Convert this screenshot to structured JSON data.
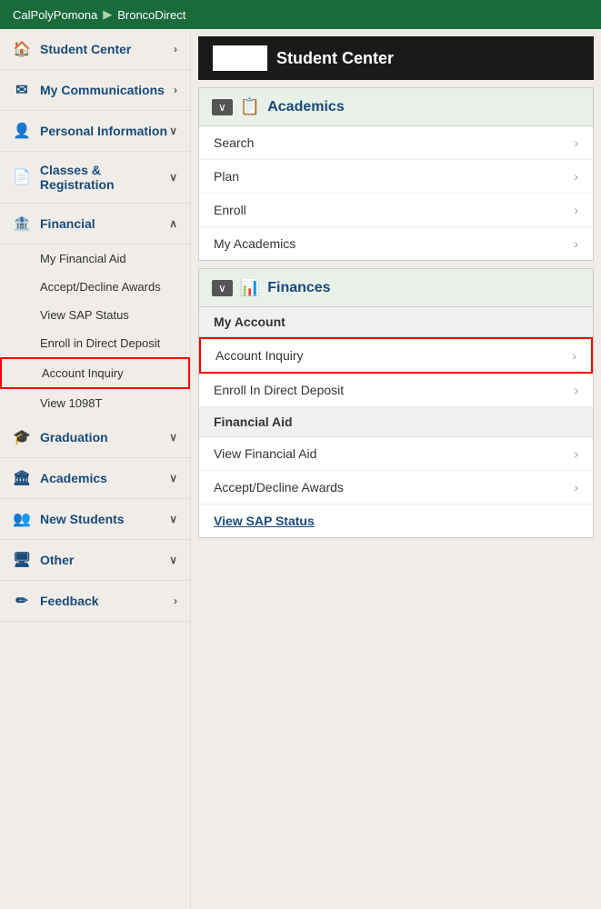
{
  "header": {
    "brand": "CalPolyPomona",
    "separator": "▶",
    "portal": "BroncoDirect"
  },
  "sidebar": {
    "items": [
      {
        "id": "student-center",
        "label": "Student Center",
        "icon": "🏠",
        "chevron": "›",
        "expanded": false,
        "submenu": []
      },
      {
        "id": "my-communications",
        "label": "My Communications",
        "icon": "✉",
        "chevron": "›",
        "expanded": false,
        "submenu": []
      },
      {
        "id": "personal-information",
        "label": "Personal Information",
        "icon": "👤",
        "chevron": "∨",
        "expanded": false,
        "submenu": []
      },
      {
        "id": "classes-registration",
        "label": "Classes & Registration",
        "icon": "📄",
        "chevron": "∨",
        "expanded": false,
        "submenu": []
      },
      {
        "id": "financial",
        "label": "Financial",
        "icon": "🏦",
        "chevron": "∧",
        "expanded": true,
        "submenu": [
          {
            "id": "my-financial-aid",
            "label": "My Financial Aid",
            "active": false
          },
          {
            "id": "accept-decline-awards",
            "label": "Accept/Decline Awards",
            "active": false
          },
          {
            "id": "view-sap-status",
            "label": "View SAP Status",
            "active": false
          },
          {
            "id": "enroll-direct-deposit",
            "label": "Enroll in Direct Deposit",
            "active": false
          },
          {
            "id": "account-inquiry",
            "label": "Account Inquiry",
            "active": true
          },
          {
            "id": "view-1098t",
            "label": "View 1098T",
            "active": false
          }
        ]
      },
      {
        "id": "graduation",
        "label": "Graduation",
        "icon": "🎓",
        "chevron": "∨",
        "expanded": false,
        "submenu": []
      },
      {
        "id": "academics",
        "label": "Academics",
        "icon": "🏛",
        "chevron": "∨",
        "expanded": false,
        "submenu": []
      },
      {
        "id": "new-students",
        "label": "New Students",
        "icon": "👥",
        "chevron": "∨",
        "expanded": false,
        "submenu": []
      },
      {
        "id": "other",
        "label": "Other",
        "icon": "🖥",
        "chevron": "∨",
        "expanded": false,
        "submenu": []
      },
      {
        "id": "feedback",
        "label": "Feedback",
        "icon": "✏",
        "chevron": "›",
        "expanded": false,
        "submenu": []
      }
    ]
  },
  "content": {
    "student_center_label": "Student Center",
    "academics_section": {
      "title": "Academics",
      "collapse_label": "∨",
      "items": [
        {
          "id": "search",
          "label": "Search"
        },
        {
          "id": "plan",
          "label": "Plan"
        },
        {
          "id": "enroll",
          "label": "Enroll"
        },
        {
          "id": "my-academics",
          "label": "My Academics"
        }
      ]
    },
    "finances_section": {
      "title": "Finances",
      "collapse_label": "∨",
      "groups": [
        {
          "header": "My Account",
          "items": [
            {
              "id": "account-inquiry",
              "label": "Account Inquiry",
              "highlighted": true
            },
            {
              "id": "enroll-direct-deposit",
              "label": "Enroll In Direct Deposit",
              "highlighted": false
            }
          ]
        },
        {
          "header": "Financial Aid",
          "items": [
            {
              "id": "view-financial-aid",
              "label": "View Financial Aid",
              "highlighted": false
            },
            {
              "id": "accept-decline-awards",
              "label": "Accept/Decline Awards",
              "highlighted": false
            }
          ]
        }
      ],
      "view_sap_label": "View SAP Status"
    }
  }
}
